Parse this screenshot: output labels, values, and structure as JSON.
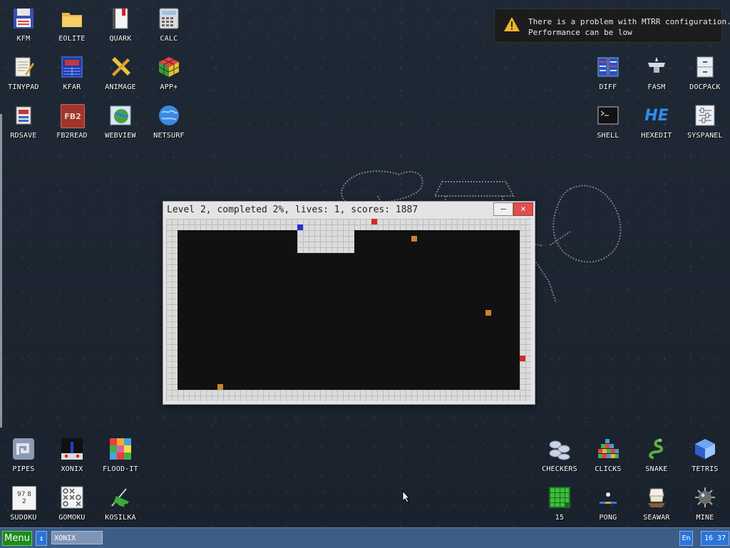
{
  "notification": {
    "icon": "warning-icon",
    "line1": "There is a problem with MTRR configuration.",
    "line2": "Performance can be low"
  },
  "window": {
    "title": "Level 2, completed 2%, lives: 1, scores: 1887",
    "minimize_label": "–",
    "close_label": "×"
  },
  "game": {
    "level": 2,
    "completed_percent": 2,
    "lives": 1,
    "scores": 1887,
    "colors": {
      "player": "#2b2bd0",
      "enemy_land": "#d42a2a",
      "enemy_sea": "#c8842a",
      "sea": "#111111",
      "land": "#dcdcdc"
    }
  },
  "desktop_icons": {
    "kfm": "KFM",
    "eolite": "EOLITE",
    "quark": "QUARK",
    "calc": "CALC",
    "tinypad": "TINYPAD",
    "kfar": "KFAR",
    "animage": "ANIMAGE",
    "app_plus": "APP+",
    "rdsave": "RDSAVE",
    "fb2read": "FB2READ",
    "webview": "WEBVIEW",
    "netsurf": "NETSURF",
    "diff": "DIFF",
    "fasm": "FASM",
    "docpack": "DOCPACK",
    "shell": "SHELL",
    "hexedit": "HEXEDIT",
    "syspanel": "SYSPANEL",
    "pipes": "PIPES",
    "xonix": "XONIX",
    "flood_it": "FLOOD-IT",
    "sudoku": "SUDOKU",
    "gomoku": "GOMOKU",
    "kosilka": "KOSILKA",
    "checkers": "CHECKERS",
    "clicks": "CLICKS",
    "snake": "SNAKE",
    "tetris": "TETRIS",
    "fifteen": "15",
    "pong": "PONG",
    "seawar": "SEAWAR",
    "mine": "MINE"
  },
  "icon_glyphs": {
    "fb2": "FB2",
    "he": "HE",
    "sudoku": "97 8 2"
  },
  "taskbar": {
    "menu_label": "Menu",
    "switch_label": "↕",
    "active_task": "XONIX",
    "lang": "En",
    "clock": "16 37"
  }
}
